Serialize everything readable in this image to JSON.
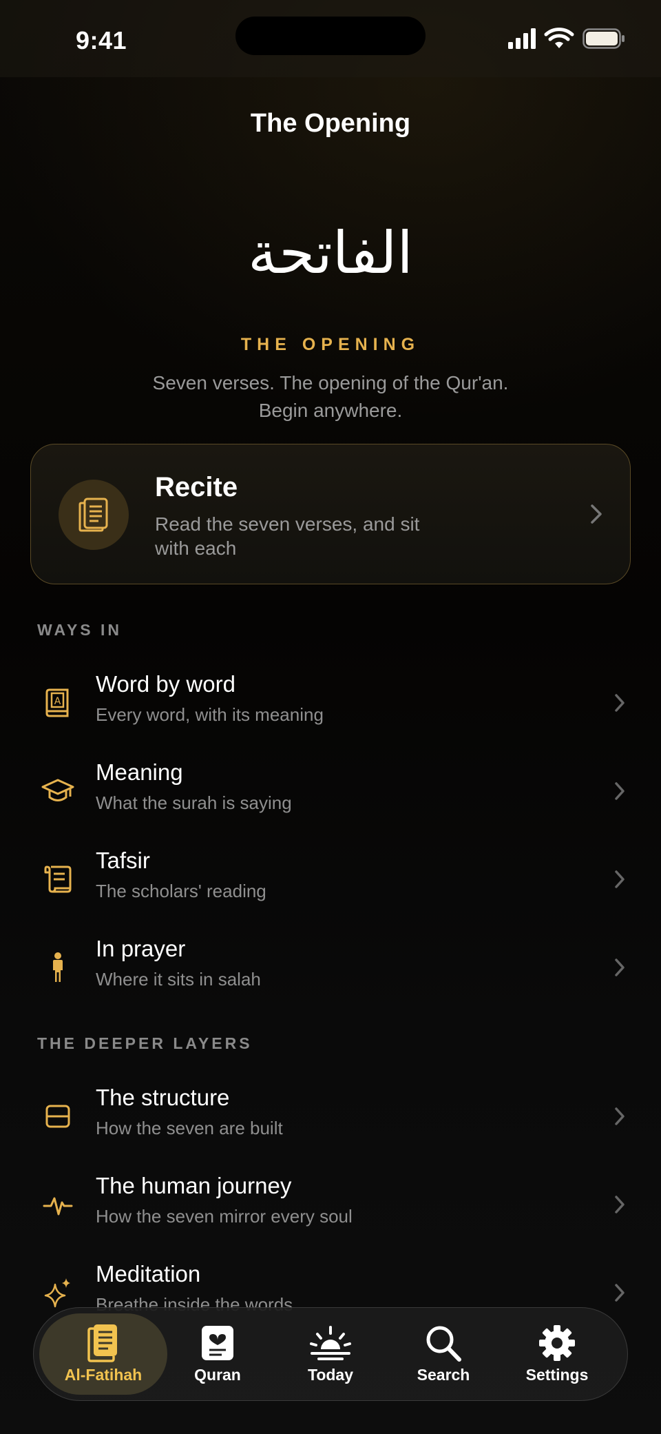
{
  "status_bar": {
    "time": "9:41"
  },
  "header": {
    "nav_title": "The Opening",
    "arabic_title": "الفاتحة",
    "eyebrow": "THE OPENING",
    "intro_line1": "Seven verses. The opening of the Qur'an.",
    "intro_line2": "Begin anywhere."
  },
  "recite": {
    "title": "Recite",
    "subtitle": "Read the seven verses, and sit with each",
    "icon": "book-pages-icon"
  },
  "sections": [
    {
      "label": "WAYS IN",
      "items": [
        {
          "title": "Word by word",
          "subtitle": "Every word, with its meaning",
          "icon": "dictionary-icon"
        },
        {
          "title": "Meaning",
          "subtitle": "What the surah is saying",
          "icon": "graduation-cap-icon"
        },
        {
          "title": "Tafsir",
          "subtitle": "The scholars' reading",
          "icon": "scroll-icon"
        },
        {
          "title": "In prayer",
          "subtitle": "Where it sits in salah",
          "icon": "standing-person-icon"
        }
      ]
    },
    {
      "label": "THE DEEPER LAYERS",
      "items": [
        {
          "title": "The structure",
          "subtitle": "How the seven are built",
          "icon": "split-square-icon"
        },
        {
          "title": "The human journey",
          "subtitle": "How the seven mirror every soul",
          "icon": "heartbeat-icon"
        },
        {
          "title": "Meditation",
          "subtitle": "Breathe inside the words",
          "icon": "sparkles-icon"
        }
      ]
    }
  ],
  "tab_bar": {
    "tabs": [
      {
        "label": "Al-Fatihah",
        "icon": "book-icon",
        "active": true
      },
      {
        "label": "Quran",
        "icon": "quran-heart-icon",
        "active": false
      },
      {
        "label": "Today",
        "icon": "sunrise-icon",
        "active": false
      },
      {
        "label": "Search",
        "icon": "magnifier-icon",
        "active": false
      },
      {
        "label": "Settings",
        "icon": "gear-icon",
        "active": false
      }
    ]
  },
  "colors": {
    "accent": "#e6b24e",
    "background": "#000000",
    "muted_text": "#9a9a9a"
  }
}
